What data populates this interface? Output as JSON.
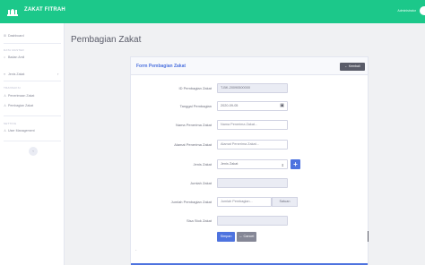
{
  "app": {
    "title": "ZAKAT FITRAH",
    "user": "Administrator"
  },
  "sidebar": {
    "dashboard": "Dashboard",
    "heading_master": "DATA MASTER",
    "badan_amil": "Badan Amil",
    "jenis_zakat": "Jenis Zakat",
    "heading_transaksi": "TRANSAKSI",
    "penerimaan": "Penerimaan Zakat",
    "pembagian": "Pembagian Zakat",
    "heading_setting": "SETTING",
    "user_management": "User Management",
    "toggle": "‹"
  },
  "page": {
    "title": "Pembagian Zakat"
  },
  "form": {
    "title": "Form Pembagian Zakat",
    "back_label": "Kembali",
    "fields": {
      "id": {
        "label": "ID Pembagian Zakat",
        "value": "T-BK-20090500000"
      },
      "tanggal": {
        "label": "Tanggal Pembagian",
        "value": "2020-09-05"
      },
      "nama": {
        "label": "Nama Penerima Zakat",
        "placeholder": "Nama Penerima Zakat..."
      },
      "alamat": {
        "label": "Alamat Penerima Zakat",
        "placeholder": "Alamat Penerima Zakat..."
      },
      "jenis": {
        "label": "Jenis Zakat",
        "selected": "Jenis Zakat"
      },
      "jumlah": {
        "label": "Jumlah Zakat",
        "value": ""
      },
      "jumlah_pembagian": {
        "label": "Jumlah Pembagian Zakat",
        "placeholder": "Jumlah Pembagian...",
        "suffix": "Satuan"
      },
      "sisa": {
        "label": "Sisa Stok Zakat",
        "value": ""
      }
    },
    "save_label": "Simpan",
    "cancel_label": "Cancel"
  },
  "colors": {
    "brand": "#1cc88a",
    "primary": "#4e73df",
    "secondary": "#858796"
  }
}
